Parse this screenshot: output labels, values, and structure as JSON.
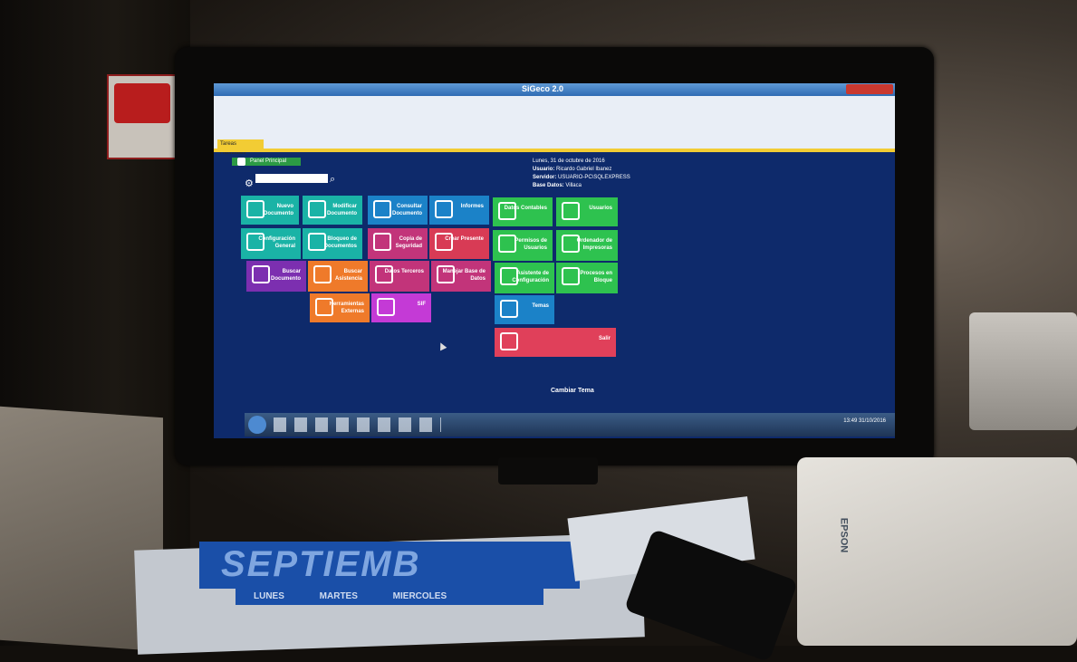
{
  "app": {
    "title": "SiGeco 2.0"
  },
  "doc_tab": "Tareas Habituales",
  "menu_button": "Panel Principal",
  "info": {
    "date": "Lunes, 31 de octubre de 2016",
    "user_label": "Usuario:",
    "user_value": "Ricardo Gabriel Ibanez",
    "server_label": "Servidor:",
    "server_value": "USUARIO-PC\\SQLEXPRESS",
    "db_label": "Base Datos:",
    "db_value": "Villaca"
  },
  "tiles": [
    {
      "id": "nuevo-documento",
      "label": "Nuevo Documento",
      "color": "#1ab3a6"
    },
    {
      "id": "modificar-documento",
      "label": "Modificar Documento",
      "color": "#1ab3a6"
    },
    {
      "id": "consultar-documento",
      "label": "Consultar Documento",
      "color": "#1b82c8"
    },
    {
      "id": "informes",
      "label": "Informes",
      "color": "#1b82c8"
    },
    {
      "id": "datos-contables",
      "label": "Datos Contables",
      "color": "#2ec24f"
    },
    {
      "id": "usuarios",
      "label": "Usuarios",
      "color": "#2ec24f"
    },
    {
      "id": "configuracion-general",
      "label": "Configuración General",
      "color": "#1ab3a6"
    },
    {
      "id": "bloqueo-documentos",
      "label": "Bloqueo de Documentos",
      "color": "#1ab3a6"
    },
    {
      "id": "copia-seguridad",
      "label": "Copia de Seguridad",
      "color": "#c2347a"
    },
    {
      "id": "crear-presente",
      "label": "Crear Presente",
      "color": "#d83b55"
    },
    {
      "id": "permisos-usuarios",
      "label": "Permisos de Usuarios",
      "color": "#2ec24f"
    },
    {
      "id": "ordenador-impresoras",
      "label": "Ordenador de Impresoras",
      "color": "#2ec24f"
    },
    {
      "id": "buscar-documento",
      "label": "Buscar Documento",
      "color": "#7c2fb0"
    },
    {
      "id": "buscar-asistencia",
      "label": "Buscar Asistencia",
      "color": "#ef7a2a"
    },
    {
      "id": "datos-terceros",
      "label": "Datos Terceros",
      "color": "#c2347a"
    },
    {
      "id": "manejar-base",
      "label": "Manejar Base de Datos",
      "color": "#c2347a"
    },
    {
      "id": "asistente-config",
      "label": "Asistente de Configuración",
      "color": "#2ec24f"
    },
    {
      "id": "procesos-bloque",
      "label": "Procesos en Bloque",
      "color": "#2ec24f"
    },
    {
      "id": "herramientas-externas",
      "label": "Herramientas Externas",
      "color": "#ef7a2a"
    },
    {
      "id": "sif",
      "label": "SIF",
      "color": "#c43ad6"
    },
    {
      "id": "temas",
      "label": "Temas",
      "color": "#1b82c8"
    },
    {
      "id": "salir",
      "label": "Salir",
      "color": "#e0405a"
    }
  ],
  "cambiar_tema": "Cambiar Tema",
  "taskbar": {
    "time": "13:49",
    "date": "31/10/2016"
  },
  "calendar": {
    "word": "SEPTIEMB",
    "days": "LUNES MARTES MIERCOLES"
  },
  "printer_brand": "EPSON"
}
